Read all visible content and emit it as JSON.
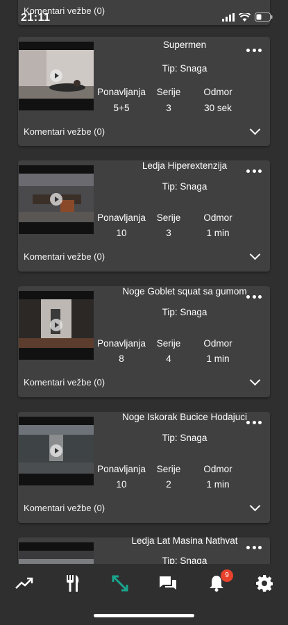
{
  "status_bar": {
    "time": "21:11"
  },
  "cards": [
    {
      "title": "",
      "type": "",
      "stats": {
        "reps_label": "",
        "reps": "",
        "sets_label": "",
        "sets": "",
        "rest_label": "",
        "rest": ""
      },
      "comments": "Komentari vežbe (0)"
    },
    {
      "title": "Supermen",
      "type": "Tip: Snaga",
      "stats": {
        "reps_label": "Ponavljanja",
        "reps": "5+5",
        "sets_label": "Serije",
        "sets": "3",
        "rest_label": "Odmor",
        "rest": "30 sek"
      },
      "comments": "Komentari vežbe (0)"
    },
    {
      "title": "Ledja Hiperextenzija",
      "type": "Tip: Snaga",
      "stats": {
        "reps_label": "Ponavljanja",
        "reps": "10",
        "sets_label": "Serije",
        "sets": "3",
        "rest_label": "Odmor",
        "rest": "1 min"
      },
      "comments": "Komentari vežbe (0)"
    },
    {
      "title": "Noge Goblet squat sa gumom",
      "type": "Tip: Snaga",
      "stats": {
        "reps_label": "Ponavljanja",
        "reps": "8",
        "sets_label": "Serije",
        "sets": "4",
        "rest_label": "Odmor",
        "rest": "1 min"
      },
      "comments": "Komentari vežbe (0)"
    },
    {
      "title": "Noge Iskorak Bucice Hodajuci",
      "type": "Tip: Snaga",
      "stats": {
        "reps_label": "Ponavljanja",
        "reps": "10",
        "sets_label": "Serije",
        "sets": "2",
        "rest_label": "Odmor",
        "rest": "1 min"
      },
      "comments": "Komentari vežbe (0)"
    },
    {
      "title": "Ledja Lat Masina Nathvat",
      "type": "Tip: Snaga",
      "stats": {
        "reps_label": "",
        "reps": "",
        "sets_label": "",
        "sets": "",
        "rest_label": "",
        "rest": ""
      },
      "comments": ""
    }
  ],
  "bottom_nav": {
    "items": [
      {
        "icon": "trending-up-icon"
      },
      {
        "icon": "fork-knife-icon"
      },
      {
        "icon": "expand-arrows-icon",
        "active": true,
        "color": "#1aa58e"
      },
      {
        "icon": "chat-bubbles-icon"
      },
      {
        "icon": "bell-icon",
        "badge": "9"
      },
      {
        "icon": "gear-icon"
      }
    ]
  },
  "colors": {
    "background": "#2f2f2f",
    "card": "#404040",
    "accent": "#1aa58e",
    "badge": "#e8412c"
  }
}
